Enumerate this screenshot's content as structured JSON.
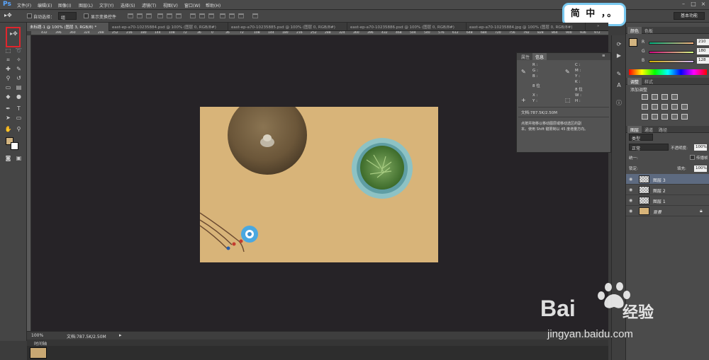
{
  "menubar": {
    "logo": "Ps",
    "items": [
      "文件(F)",
      "编辑(E)",
      "图像(I)",
      "图层(L)",
      "文字(Y)",
      "选择(S)",
      "滤镜(T)",
      "视图(V)",
      "窗口(W)",
      "帮助(H)"
    ]
  },
  "options": {
    "auto_select_label": "自动选择：",
    "auto_select_value": "组",
    "show_transform_label": "显示变换控件",
    "workspace": "基本功能"
  },
  "callout": {
    "text": "简 中 ，。"
  },
  "tabs": [
    {
      "label": "未标题-1 @ 100% (图层 3, RGB/8) *",
      "active": true
    },
    {
      "label": "east-ep-a70-10235884.psd @ 100% (图层 0, RGB/8#)",
      "active": false
    },
    {
      "label": "east-ep-a70-10235885.psd @ 100% (图层 0, RGB/8#)",
      "active": false
    },
    {
      "label": "east-ep-a70-10235886.psd @ 100% (图层 0, RGB/8#)",
      "active": false
    },
    {
      "label": "east-ep-a70-10235884.jpg @ 100% (图层 0, RGB/8#)",
      "active": false
    }
  ],
  "ruler_ticks": [
    "432",
    "396",
    "360",
    "324",
    "288",
    "252",
    "216",
    "180",
    "144",
    "108",
    "72",
    "36",
    "0",
    "36",
    "72",
    "108",
    "144",
    "180",
    "216",
    "252",
    "288",
    "324",
    "360",
    "396",
    "432",
    "468",
    "504",
    "540",
    "576",
    "612",
    "648",
    "684",
    "720",
    "756",
    "792",
    "828",
    "864",
    "900",
    "936",
    "972"
  ],
  "info_panel": {
    "tabs": [
      "属性",
      "信息"
    ],
    "rgb_labels": [
      "R :",
      "G :",
      "B :"
    ],
    "cmyk_labels": [
      "C :",
      "M :",
      "Y :",
      "K :"
    ],
    "bit_labels": [
      "8 位",
      "8 位"
    ],
    "xy_labels": [
      "X :",
      "Y :"
    ],
    "wh_labels": [
      "W :",
      "H :"
    ],
    "doc_size": "文档:787.5K/2.50M",
    "hint_line1": "点按并拖移以移动图层或移动选区的副",
    "hint_line2": "本。使用 Shift 键限制以 45 度增量方向。"
  },
  "color_panel": {
    "tabs": [
      "颜色",
      "色板"
    ],
    "channels": [
      {
        "label": "R",
        "value": "210"
      },
      {
        "label": "G",
        "value": "180"
      },
      {
        "label": "B",
        "value": "128"
      }
    ],
    "foreground": "#d2b480"
  },
  "adjust_panel": {
    "tabs": [
      "调整",
      "样式"
    ],
    "title": "添加调整"
  },
  "layers_panel": {
    "tabs": [
      "图层",
      "通道",
      "路径"
    ],
    "kind_label": "类型",
    "blend_mode": "正常",
    "opacity_label": "不透明度:",
    "opacity_value": "100%",
    "unify_label": "统一:",
    "propagate_label": "传播帧",
    "lock_label": "锁定:",
    "fill_label": "填充:",
    "fill_value": "100%",
    "layers": [
      {
        "name": "图层 3",
        "selected": true
      },
      {
        "name": "图层 2",
        "selected": false
      },
      {
        "name": "图层 1",
        "selected": false
      },
      {
        "name": "背景",
        "selected": false
      }
    ]
  },
  "status": {
    "zoom": "100%",
    "doc": "文档:787.5K/2.50M"
  },
  "timeline": {
    "label": "时间轴"
  },
  "colors": {
    "canvas_bg": "#d8b479",
    "accent": "#78c8ef",
    "highlight": "#e0262d"
  },
  "watermark": {
    "brand": "Bai",
    "brand_suffix": "经验",
    "url": "jingyan.baidu.com"
  }
}
